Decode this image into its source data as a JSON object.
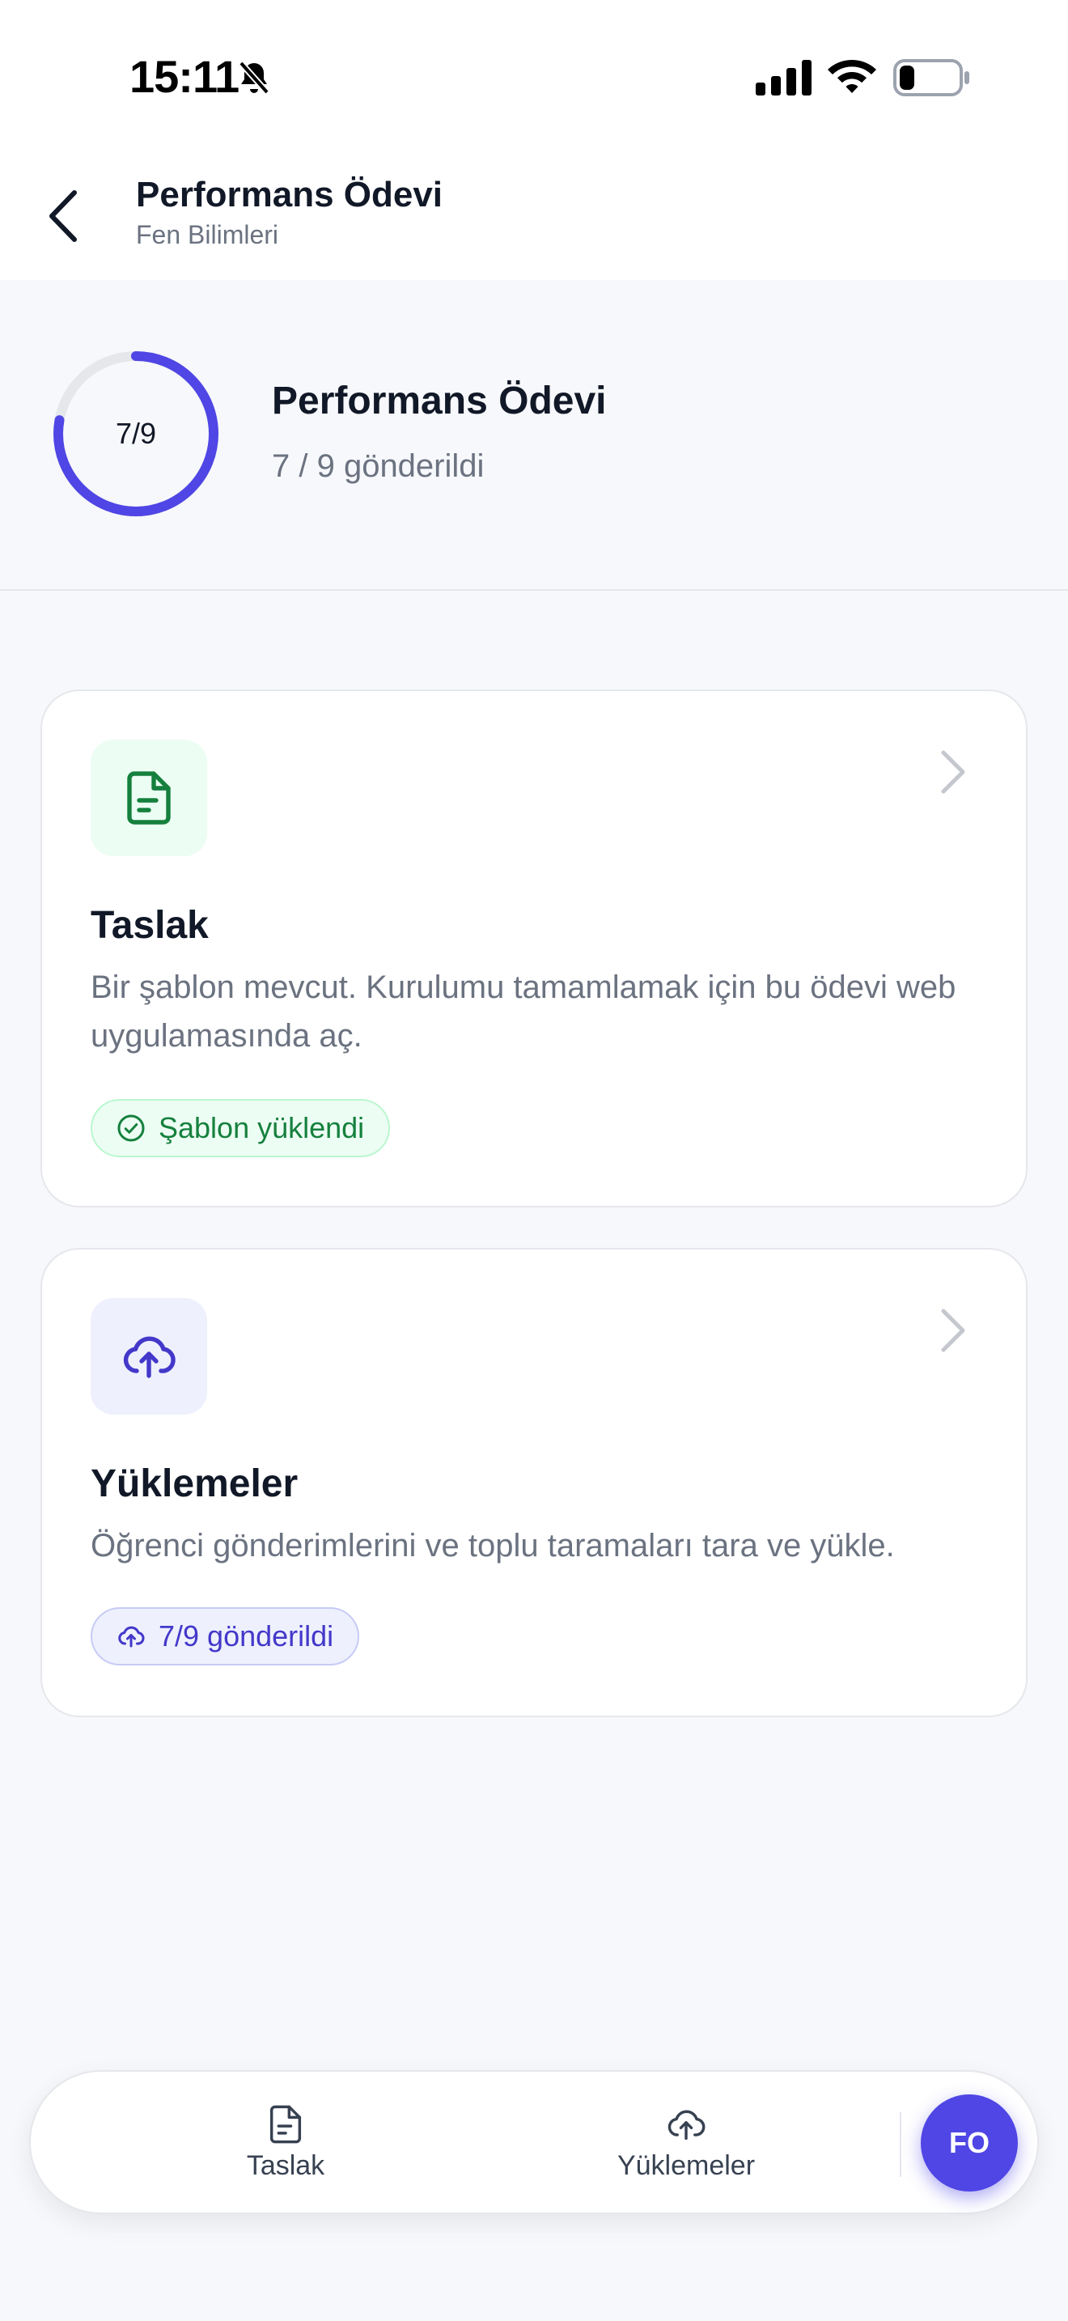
{
  "status_bar": {
    "time": "15:11",
    "icons": [
      "bell-slash-icon",
      "cellular-signal-icon",
      "wifi-icon",
      "battery-icon"
    ]
  },
  "header": {
    "title": "Performans Ödevi",
    "subtitle": "Fen Bilimleri",
    "back_icon": "chevron-left-icon"
  },
  "summary": {
    "progress_label": "7/9",
    "submitted": 7,
    "total": 9,
    "title": "Performans Ödevi",
    "status": "7 / 9 gönderildi"
  },
  "cards": {
    "draft": {
      "icon": "document-icon",
      "title": "Taslak",
      "description": "Bir şablon mevcut. Kurulumu tamamlamak için bu ödevi web uygulamasında aç.",
      "badge": "Şablon yüklendi",
      "badge_icon": "check-circle-icon"
    },
    "uploads": {
      "icon": "cloud-upload-icon",
      "title": "Yüklemeler",
      "description": "Öğrenci gönderimlerini ve toplu taramaları tara ve yükle.",
      "badge": "7/9 gönderildi",
      "badge_icon": "cloud-upload-icon"
    }
  },
  "tab_bar": {
    "tabs": [
      {
        "label": "Taslak",
        "icon": "document-icon"
      },
      {
        "label": "Yüklemeler",
        "icon": "cloud-upload-icon"
      }
    ],
    "avatar_initials": "FO"
  },
  "colors": {
    "accent": "#4f46e5",
    "success": "#15803d",
    "success_bg": "#ecfdf3",
    "accent_bg": "#eef0fd",
    "text_primary": "#111827",
    "text_secondary": "#6b7280"
  }
}
